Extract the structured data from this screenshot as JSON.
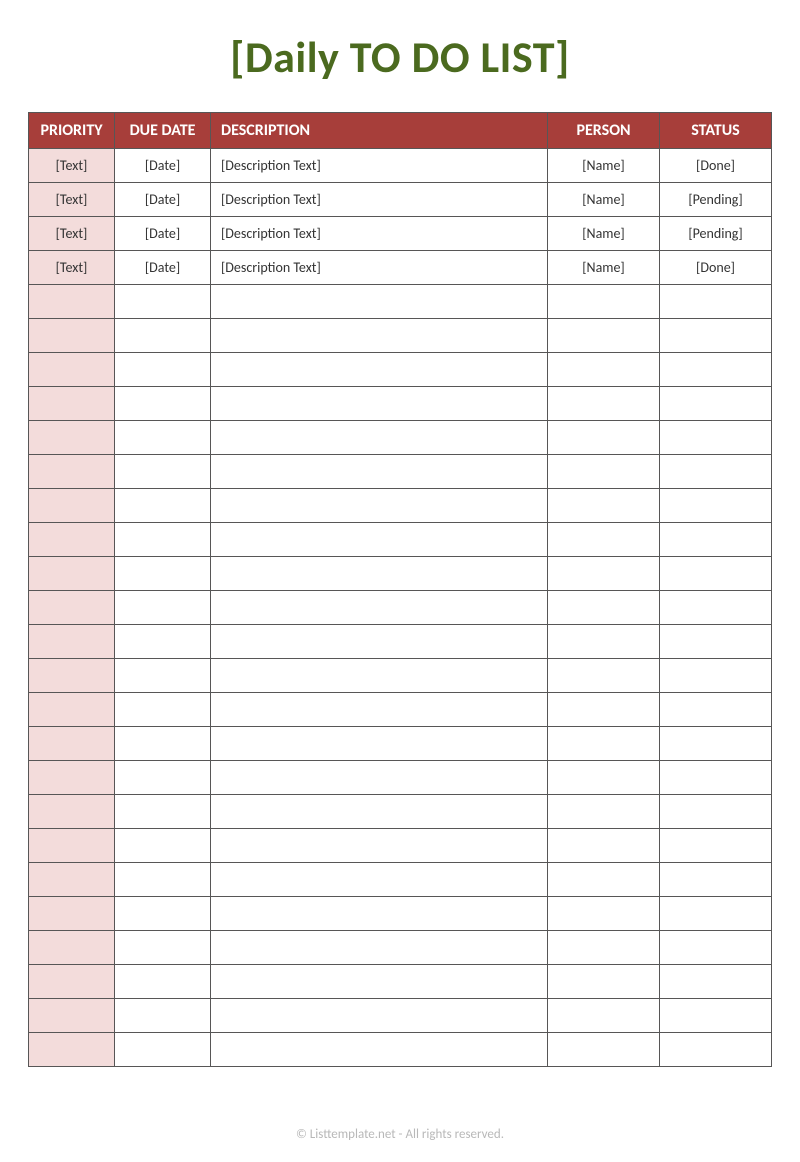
{
  "title": "[Daily TO DO LIST]",
  "columns": {
    "priority": "PRIORITY",
    "due_date": "DUE DATE",
    "description": "DESCRIPTION",
    "person": "PERSON",
    "status": "STATUS"
  },
  "rows": [
    {
      "priority": "[Text]",
      "due_date": "[Date]",
      "description": "[Description Text]",
      "person": "[Name]",
      "status": "[Done]"
    },
    {
      "priority": "[Text]",
      "due_date": "[Date]",
      "description": "[Description Text]",
      "person": "[Name]",
      "status": "[Pending]"
    },
    {
      "priority": "[Text]",
      "due_date": "[Date]",
      "description": "[Description Text]",
      "person": "[Name]",
      "status": "[Pending]"
    },
    {
      "priority": "[Text]",
      "due_date": "[Date]",
      "description": "[Description Text]",
      "person": "[Name]",
      "status": "[Done]"
    },
    {
      "priority": "",
      "due_date": "",
      "description": "",
      "person": "",
      "status": ""
    },
    {
      "priority": "",
      "due_date": "",
      "description": "",
      "person": "",
      "status": ""
    },
    {
      "priority": "",
      "due_date": "",
      "description": "",
      "person": "",
      "status": ""
    },
    {
      "priority": "",
      "due_date": "",
      "description": "",
      "person": "",
      "status": ""
    },
    {
      "priority": "",
      "due_date": "",
      "description": "",
      "person": "",
      "status": ""
    },
    {
      "priority": "",
      "due_date": "",
      "description": "",
      "person": "",
      "status": ""
    },
    {
      "priority": "",
      "due_date": "",
      "description": "",
      "person": "",
      "status": ""
    },
    {
      "priority": "",
      "due_date": "",
      "description": "",
      "person": "",
      "status": ""
    },
    {
      "priority": "",
      "due_date": "",
      "description": "",
      "person": "",
      "status": ""
    },
    {
      "priority": "",
      "due_date": "",
      "description": "",
      "person": "",
      "status": ""
    },
    {
      "priority": "",
      "due_date": "",
      "description": "",
      "person": "",
      "status": ""
    },
    {
      "priority": "",
      "due_date": "",
      "description": "",
      "person": "",
      "status": ""
    },
    {
      "priority": "",
      "due_date": "",
      "description": "",
      "person": "",
      "status": ""
    },
    {
      "priority": "",
      "due_date": "",
      "description": "",
      "person": "",
      "status": ""
    },
    {
      "priority": "",
      "due_date": "",
      "description": "",
      "person": "",
      "status": ""
    },
    {
      "priority": "",
      "due_date": "",
      "description": "",
      "person": "",
      "status": ""
    },
    {
      "priority": "",
      "due_date": "",
      "description": "",
      "person": "",
      "status": ""
    },
    {
      "priority": "",
      "due_date": "",
      "description": "",
      "person": "",
      "status": ""
    },
    {
      "priority": "",
      "due_date": "",
      "description": "",
      "person": "",
      "status": ""
    },
    {
      "priority": "",
      "due_date": "",
      "description": "",
      "person": "",
      "status": ""
    },
    {
      "priority": "",
      "due_date": "",
      "description": "",
      "person": "",
      "status": ""
    },
    {
      "priority": "",
      "due_date": "",
      "description": "",
      "person": "",
      "status": ""
    },
    {
      "priority": "",
      "due_date": "",
      "description": "",
      "person": "",
      "status": ""
    }
  ],
  "footer": "© Listtemplate.net - All rights reserved."
}
